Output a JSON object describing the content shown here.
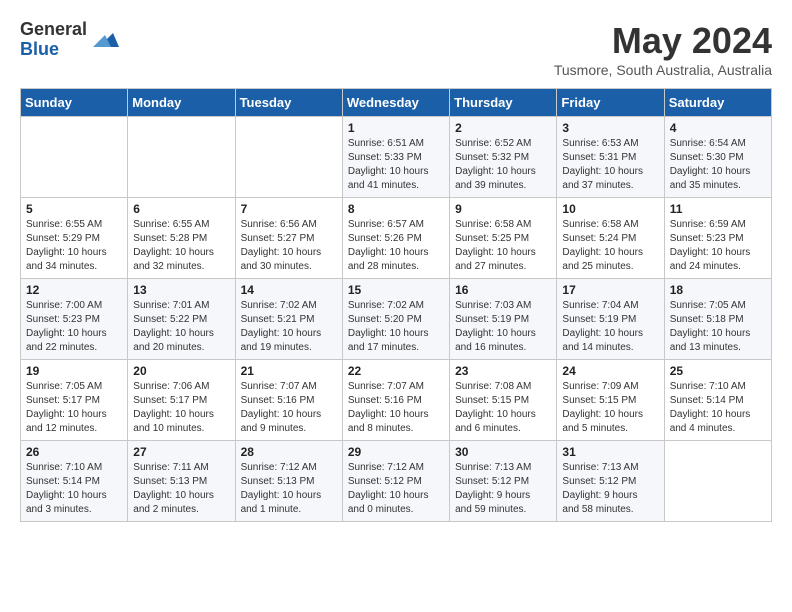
{
  "logo": {
    "general": "General",
    "blue": "Blue"
  },
  "title": "May 2024",
  "location": "Tusmore, South Australia, Australia",
  "days_of_week": [
    "Sunday",
    "Monday",
    "Tuesday",
    "Wednesday",
    "Thursday",
    "Friday",
    "Saturday"
  ],
  "weeks": [
    [
      {
        "day": "",
        "info": ""
      },
      {
        "day": "",
        "info": ""
      },
      {
        "day": "",
        "info": ""
      },
      {
        "day": "1",
        "info": "Sunrise: 6:51 AM\nSunset: 5:33 PM\nDaylight: 10 hours\nand 41 minutes."
      },
      {
        "day": "2",
        "info": "Sunrise: 6:52 AM\nSunset: 5:32 PM\nDaylight: 10 hours\nand 39 minutes."
      },
      {
        "day": "3",
        "info": "Sunrise: 6:53 AM\nSunset: 5:31 PM\nDaylight: 10 hours\nand 37 minutes."
      },
      {
        "day": "4",
        "info": "Sunrise: 6:54 AM\nSunset: 5:30 PM\nDaylight: 10 hours\nand 35 minutes."
      }
    ],
    [
      {
        "day": "5",
        "info": "Sunrise: 6:55 AM\nSunset: 5:29 PM\nDaylight: 10 hours\nand 34 minutes."
      },
      {
        "day": "6",
        "info": "Sunrise: 6:55 AM\nSunset: 5:28 PM\nDaylight: 10 hours\nand 32 minutes."
      },
      {
        "day": "7",
        "info": "Sunrise: 6:56 AM\nSunset: 5:27 PM\nDaylight: 10 hours\nand 30 minutes."
      },
      {
        "day": "8",
        "info": "Sunrise: 6:57 AM\nSunset: 5:26 PM\nDaylight: 10 hours\nand 28 minutes."
      },
      {
        "day": "9",
        "info": "Sunrise: 6:58 AM\nSunset: 5:25 PM\nDaylight: 10 hours\nand 27 minutes."
      },
      {
        "day": "10",
        "info": "Sunrise: 6:58 AM\nSunset: 5:24 PM\nDaylight: 10 hours\nand 25 minutes."
      },
      {
        "day": "11",
        "info": "Sunrise: 6:59 AM\nSunset: 5:23 PM\nDaylight: 10 hours\nand 24 minutes."
      }
    ],
    [
      {
        "day": "12",
        "info": "Sunrise: 7:00 AM\nSunset: 5:23 PM\nDaylight: 10 hours\nand 22 minutes."
      },
      {
        "day": "13",
        "info": "Sunrise: 7:01 AM\nSunset: 5:22 PM\nDaylight: 10 hours\nand 20 minutes."
      },
      {
        "day": "14",
        "info": "Sunrise: 7:02 AM\nSunset: 5:21 PM\nDaylight: 10 hours\nand 19 minutes."
      },
      {
        "day": "15",
        "info": "Sunrise: 7:02 AM\nSunset: 5:20 PM\nDaylight: 10 hours\nand 17 minutes."
      },
      {
        "day": "16",
        "info": "Sunrise: 7:03 AM\nSunset: 5:19 PM\nDaylight: 10 hours\nand 16 minutes."
      },
      {
        "day": "17",
        "info": "Sunrise: 7:04 AM\nSunset: 5:19 PM\nDaylight: 10 hours\nand 14 minutes."
      },
      {
        "day": "18",
        "info": "Sunrise: 7:05 AM\nSunset: 5:18 PM\nDaylight: 10 hours\nand 13 minutes."
      }
    ],
    [
      {
        "day": "19",
        "info": "Sunrise: 7:05 AM\nSunset: 5:17 PM\nDaylight: 10 hours\nand 12 minutes."
      },
      {
        "day": "20",
        "info": "Sunrise: 7:06 AM\nSunset: 5:17 PM\nDaylight: 10 hours\nand 10 minutes."
      },
      {
        "day": "21",
        "info": "Sunrise: 7:07 AM\nSunset: 5:16 PM\nDaylight: 10 hours\nand 9 minutes."
      },
      {
        "day": "22",
        "info": "Sunrise: 7:07 AM\nSunset: 5:16 PM\nDaylight: 10 hours\nand 8 minutes."
      },
      {
        "day": "23",
        "info": "Sunrise: 7:08 AM\nSunset: 5:15 PM\nDaylight: 10 hours\nand 6 minutes."
      },
      {
        "day": "24",
        "info": "Sunrise: 7:09 AM\nSunset: 5:15 PM\nDaylight: 10 hours\nand 5 minutes."
      },
      {
        "day": "25",
        "info": "Sunrise: 7:10 AM\nSunset: 5:14 PM\nDaylight: 10 hours\nand 4 minutes."
      }
    ],
    [
      {
        "day": "26",
        "info": "Sunrise: 7:10 AM\nSunset: 5:14 PM\nDaylight: 10 hours\nand 3 minutes."
      },
      {
        "day": "27",
        "info": "Sunrise: 7:11 AM\nSunset: 5:13 PM\nDaylight: 10 hours\nand 2 minutes."
      },
      {
        "day": "28",
        "info": "Sunrise: 7:12 AM\nSunset: 5:13 PM\nDaylight: 10 hours\nand 1 minute."
      },
      {
        "day": "29",
        "info": "Sunrise: 7:12 AM\nSunset: 5:12 PM\nDaylight: 10 hours\nand 0 minutes."
      },
      {
        "day": "30",
        "info": "Sunrise: 7:13 AM\nSunset: 5:12 PM\nDaylight: 9 hours\nand 59 minutes."
      },
      {
        "day": "31",
        "info": "Sunrise: 7:13 AM\nSunset: 5:12 PM\nDaylight: 9 hours\nand 58 minutes."
      },
      {
        "day": "",
        "info": ""
      }
    ]
  ]
}
